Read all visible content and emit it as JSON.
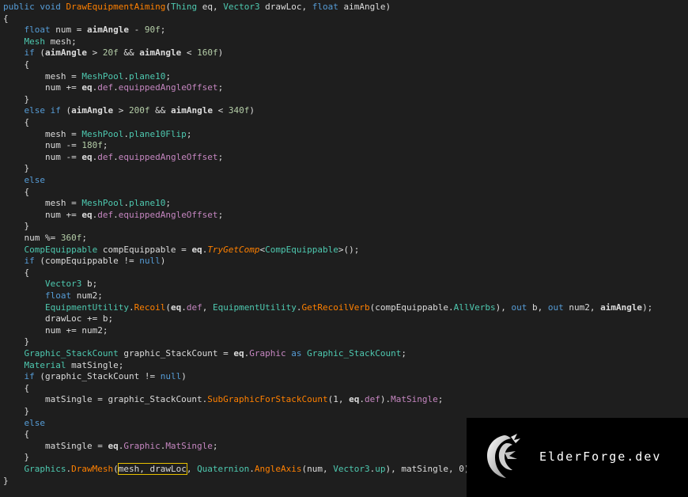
{
  "editor": {
    "language": "C#",
    "lines": [
      [
        [
          "kw",
          "public "
        ],
        [
          "kw",
          "void "
        ],
        [
          "mth",
          "DrawEquipmentAiming"
        ],
        [
          "txt",
          "("
        ],
        [
          "typ",
          "Thing"
        ],
        [
          "txt",
          " eq, "
        ],
        [
          "typ",
          "Vector3"
        ],
        [
          "txt",
          " drawLoc, "
        ],
        [
          "kw",
          "float"
        ],
        [
          "txt",
          " aimAngle)"
        ]
      ],
      [
        [
          "txt",
          "{"
        ]
      ],
      [
        [
          "txt",
          "    "
        ],
        [
          "kw",
          "float"
        ],
        [
          "txt",
          " num = "
        ],
        [
          "par",
          "aimAngle"
        ],
        [
          "txt",
          " - "
        ],
        [
          "num",
          "90f"
        ],
        [
          "txt",
          ";"
        ]
      ],
      [
        [
          "txt",
          "    "
        ],
        [
          "typ",
          "Mesh"
        ],
        [
          "txt",
          " mesh;"
        ]
      ],
      [
        [
          "txt",
          "    "
        ],
        [
          "kw",
          "if"
        ],
        [
          "txt",
          " ("
        ],
        [
          "par",
          "aimAngle"
        ],
        [
          "txt",
          " > "
        ],
        [
          "num",
          "20f"
        ],
        [
          "txt",
          " && "
        ],
        [
          "par",
          "aimAngle"
        ],
        [
          "txt",
          " < "
        ],
        [
          "num",
          "160f"
        ],
        [
          "txt",
          ")"
        ]
      ],
      [
        [
          "txt",
          "    {"
        ]
      ],
      [
        [
          "txt",
          "        mesh = "
        ],
        [
          "mem",
          "MeshPool"
        ],
        [
          "txt",
          "."
        ],
        [
          "mem",
          "plane10"
        ],
        [
          "txt",
          ";"
        ]
      ],
      [
        [
          "txt",
          "        num += "
        ],
        [
          "par",
          "eq"
        ],
        [
          "txt",
          "."
        ],
        [
          "prp",
          "def"
        ],
        [
          "txt",
          "."
        ],
        [
          "prp",
          "equippedAngleOffset"
        ],
        [
          "txt",
          ";"
        ]
      ],
      [
        [
          "txt",
          "    }"
        ]
      ],
      [
        [
          "txt",
          "    "
        ],
        [
          "kw",
          "else if"
        ],
        [
          "txt",
          " ("
        ],
        [
          "par",
          "aimAngle"
        ],
        [
          "txt",
          " > "
        ],
        [
          "num",
          "200f"
        ],
        [
          "txt",
          " && "
        ],
        [
          "par",
          "aimAngle"
        ],
        [
          "txt",
          " < "
        ],
        [
          "num",
          "340f"
        ],
        [
          "txt",
          ")"
        ]
      ],
      [
        [
          "txt",
          "    {"
        ]
      ],
      [
        [
          "txt",
          "        mesh = "
        ],
        [
          "mem",
          "MeshPool"
        ],
        [
          "txt",
          "."
        ],
        [
          "mem",
          "plane10Flip"
        ],
        [
          "txt",
          ";"
        ]
      ],
      [
        [
          "txt",
          "        num -= "
        ],
        [
          "num",
          "180f"
        ],
        [
          "txt",
          ";"
        ]
      ],
      [
        [
          "txt",
          "        num -= "
        ],
        [
          "par",
          "eq"
        ],
        [
          "txt",
          "."
        ],
        [
          "prp",
          "def"
        ],
        [
          "txt",
          "."
        ],
        [
          "prp",
          "equippedAngleOffset"
        ],
        [
          "txt",
          ";"
        ]
      ],
      [
        [
          "txt",
          "    }"
        ]
      ],
      [
        [
          "txt",
          "    "
        ],
        [
          "kw",
          "else"
        ]
      ],
      [
        [
          "txt",
          "    {"
        ]
      ],
      [
        [
          "txt",
          "        mesh = "
        ],
        [
          "mem",
          "MeshPool"
        ],
        [
          "txt",
          "."
        ],
        [
          "mem",
          "plane10"
        ],
        [
          "txt",
          ";"
        ]
      ],
      [
        [
          "txt",
          "        num += "
        ],
        [
          "par",
          "eq"
        ],
        [
          "txt",
          "."
        ],
        [
          "prp",
          "def"
        ],
        [
          "txt",
          "."
        ],
        [
          "prp",
          "equippedAngleOffset"
        ],
        [
          "txt",
          ";"
        ]
      ],
      [
        [
          "txt",
          "    }"
        ]
      ],
      [
        [
          "txt",
          "    num %= "
        ],
        [
          "num",
          "360f"
        ],
        [
          "txt",
          ";"
        ]
      ],
      [
        [
          "txt",
          "    "
        ],
        [
          "typ",
          "CompEquippable"
        ],
        [
          "txt",
          " compEquippable = "
        ],
        [
          "par",
          "eq"
        ],
        [
          "txt",
          "."
        ],
        [
          "ital",
          "TryGetComp"
        ],
        [
          "txt",
          "<"
        ],
        [
          "typ",
          "CompEquippable"
        ],
        [
          "txt",
          ">();"
        ]
      ],
      [
        [
          "txt",
          "    "
        ],
        [
          "kw",
          "if"
        ],
        [
          "txt",
          " (compEquippable != "
        ],
        [
          "kw",
          "null"
        ],
        [
          "txt",
          ")"
        ]
      ],
      [
        [
          "txt",
          "    {"
        ]
      ],
      [
        [
          "txt",
          "        "
        ],
        [
          "typ",
          "Vector3"
        ],
        [
          "txt",
          " b;"
        ]
      ],
      [
        [
          "txt",
          "        "
        ],
        [
          "kw",
          "float"
        ],
        [
          "txt",
          " num2;"
        ]
      ],
      [
        [
          "txt",
          "        "
        ],
        [
          "typ",
          "EquipmentUtility"
        ],
        [
          "txt",
          "."
        ],
        [
          "mth",
          "Recoil"
        ],
        [
          "txt",
          "("
        ],
        [
          "par",
          "eq"
        ],
        [
          "txt",
          "."
        ],
        [
          "prp",
          "def"
        ],
        [
          "txt",
          ", "
        ],
        [
          "typ",
          "EquipmentUtility"
        ],
        [
          "txt",
          "."
        ],
        [
          "mth",
          "GetRecoilVerb"
        ],
        [
          "txt",
          "(compEquippable."
        ],
        [
          "mem",
          "AllVerbs"
        ],
        [
          "txt",
          "), "
        ],
        [
          "kw",
          "out"
        ],
        [
          "txt",
          " b, "
        ],
        [
          "kw",
          "out"
        ],
        [
          "txt",
          " num2, "
        ],
        [
          "par",
          "aimAngle"
        ],
        [
          "txt",
          ");"
        ]
      ],
      [
        [
          "txt",
          "        drawLoc += b;"
        ]
      ],
      [
        [
          "txt",
          "        num += num2;"
        ]
      ],
      [
        [
          "txt",
          "    }"
        ]
      ],
      [
        [
          "txt",
          "    "
        ],
        [
          "typ",
          "Graphic_StackCount"
        ],
        [
          "txt",
          " graphic_StackCount = "
        ],
        [
          "par",
          "eq"
        ],
        [
          "txt",
          "."
        ],
        [
          "prp",
          "Graphic"
        ],
        [
          "txt",
          " "
        ],
        [
          "kw",
          "as"
        ],
        [
          "txt",
          " "
        ],
        [
          "typ",
          "Graphic_StackCount"
        ],
        [
          "txt",
          ";"
        ]
      ],
      [
        [
          "txt",
          "    "
        ],
        [
          "typ",
          "Material"
        ],
        [
          "txt",
          " matSingle;"
        ]
      ],
      [
        [
          "txt",
          "    "
        ],
        [
          "kw",
          "if"
        ],
        [
          "txt",
          " (graphic_StackCount != "
        ],
        [
          "kw",
          "null"
        ],
        [
          "txt",
          ")"
        ]
      ],
      [
        [
          "txt",
          "    {"
        ]
      ],
      [
        [
          "txt",
          "        matSingle = graphic_StackCount."
        ],
        [
          "mth",
          "SubGraphicForStackCount"
        ],
        [
          "txt",
          "(1, "
        ],
        [
          "par",
          "eq"
        ],
        [
          "txt",
          "."
        ],
        [
          "prp",
          "def"
        ],
        [
          "txt",
          ")."
        ],
        [
          "prp",
          "MatSingle"
        ],
        [
          "txt",
          ";"
        ]
      ],
      [
        [
          "txt",
          "    }"
        ]
      ],
      [
        [
          "txt",
          "    "
        ],
        [
          "kw",
          "else"
        ]
      ],
      [
        [
          "txt",
          "    {"
        ]
      ],
      [
        [
          "txt",
          "        matSingle = "
        ],
        [
          "par",
          "eq"
        ],
        [
          "txt",
          "."
        ],
        [
          "prp",
          "Graphic"
        ],
        [
          "txt",
          "."
        ],
        [
          "prp",
          "MatSingle"
        ],
        [
          "txt",
          ";"
        ]
      ],
      [
        [
          "txt",
          "    }"
        ]
      ],
      [
        [
          "txt",
          "    "
        ],
        [
          "typ",
          "Graphics"
        ],
        [
          "txt",
          "."
        ],
        [
          "mth",
          "DrawMesh"
        ],
        [
          "txt",
          "("
        ],
        [
          "hl",
          "mesh, drawLoc"
        ],
        [
          "txt",
          ", "
        ],
        [
          "typ",
          "Quaternion"
        ],
        [
          "txt",
          "."
        ],
        [
          "mth",
          "AngleAxis"
        ],
        [
          "txt",
          "(num, "
        ],
        [
          "typ",
          "Vector3"
        ],
        [
          "txt",
          "."
        ],
        [
          "mem",
          "up"
        ],
        [
          "txt",
          "), matSingle, 0);"
        ]
      ],
      [
        [
          "txt",
          "}"
        ]
      ]
    ]
  },
  "brand": {
    "logo_icon": "dragon-logo-icon",
    "name": "ElderForge.dev",
    "panel_color": "#000000"
  }
}
